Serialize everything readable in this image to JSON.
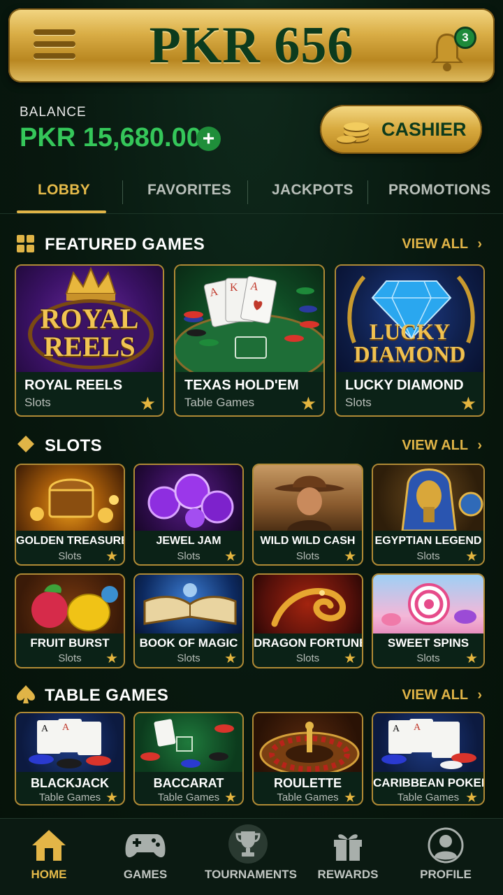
{
  "header": {
    "brand": "PKR 656",
    "notification_count": "3"
  },
  "balance": {
    "label": "BALANCE",
    "value": "PKR 15,680.00",
    "add_symbol": "+"
  },
  "cashier": {
    "label": "CASHIER"
  },
  "tabs": [
    {
      "label": "LOBBY",
      "active": true
    },
    {
      "label": "FAVORITES"
    },
    {
      "label": "JACKPOTS"
    },
    {
      "label": "PROMOTIONS"
    }
  ],
  "featured": {
    "title": "FEATURED GAMES",
    "view_all": "VIEW ALL",
    "items": [
      {
        "name": "ROYAL REELS",
        "category": "Slots",
        "art_text_1": "ROYAL",
        "art_text_2": "REELS"
      },
      {
        "name": "TEXAS HOLD'EM",
        "category": "Table Games"
      },
      {
        "name": "LUCKY DIAMOND",
        "category": "Slots",
        "art_text_1": "LUCKY",
        "art_text_2": "DIAMOND"
      }
    ]
  },
  "slots": {
    "title": "SLOTS",
    "view_all": "VIEW ALL",
    "items": [
      {
        "name": "GOLDEN TREASURE",
        "category": "Slots"
      },
      {
        "name": "JEWEL JAM",
        "category": "Slots"
      },
      {
        "name": "WILD WILD CASH",
        "category": "Slots"
      },
      {
        "name": "EGYPTIAN LEGEND",
        "category": "Slots"
      },
      {
        "name": "FRUIT BURST",
        "category": "Slots"
      },
      {
        "name": "BOOK OF MAGIC",
        "category": "Slots"
      },
      {
        "name": "DRAGON FORTUNE",
        "category": "Slots"
      },
      {
        "name": "SWEET SPINS",
        "category": "Slots"
      }
    ]
  },
  "table_games": {
    "title": "TABLE GAMES",
    "view_all": "VIEW ALL",
    "items": [
      {
        "name": "BLACKJACK",
        "category": "Table Games"
      },
      {
        "name": "BACCARAT",
        "category": "Table Games"
      },
      {
        "name": "ROULETTE",
        "category": "Table Games"
      },
      {
        "name": "CARIBBEAN POKER",
        "category": "Table Games"
      }
    ]
  },
  "bottom_nav": [
    {
      "label": "HOME",
      "icon": "home-icon",
      "active": true
    },
    {
      "label": "GAMES",
      "icon": "gamepad-icon"
    },
    {
      "label": "TOURNAMENTS",
      "icon": "trophy-icon"
    },
    {
      "label": "REWARDS",
      "icon": "gift-icon"
    },
    {
      "label": "PROFILE",
      "icon": "profile-icon"
    }
  ],
  "colors": {
    "gold": "#e0b447",
    "balance_green": "#35c75a",
    "background": "#08180f"
  }
}
